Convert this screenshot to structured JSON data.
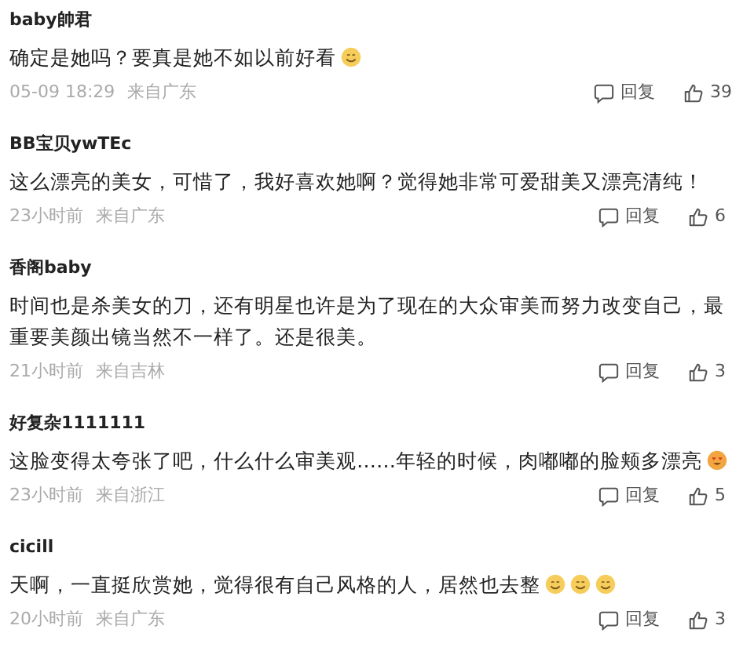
{
  "comments": [
    {
      "user": "baby帥君",
      "text": "确定是她吗？要真是她不如以前好看",
      "emojis": [
        {
          "kind": "smile"
        }
      ],
      "time": "05-09 18:29",
      "location": "来自广东",
      "reply": "回复",
      "likes": "39"
    },
    {
      "user": "BB宝贝ywTEc",
      "text": "这么漂亮的美女，可惜了，我好喜欢她啊？觉得她非常可爱甜美又漂亮清纯！",
      "time": "23小时前",
      "location": "来自广东",
      "reply": "回复",
      "likes": "6"
    },
    {
      "user": "香阁baby",
      "text": "时间也是杀美女的刀，还有明星也许是为了现在的大众审美而努力改变自己，最重要美颜出镜当然不一样了。还是很美。",
      "time": "21小时前",
      "location": "来自吉林",
      "reply": "回复",
      "likes": "3"
    },
    {
      "user": "好复杂1111111",
      "text": "这脸变得太夸张了吧，什么什么审美观……年轻的时候，肉嘟嘟的脸颊多漂亮",
      "emojis": [
        {
          "kind": "heart-eyes"
        }
      ],
      "time": "23小时前",
      "location": "来自浙江",
      "reply": "回复",
      "likes": "5"
    },
    {
      "user": "cicill",
      "text": "天啊，一直挺欣赏她，觉得很有自己风格的人，居然也去整",
      "emojis": [
        {
          "kind": "smile"
        },
        {
          "kind": "smile"
        },
        {
          "kind": "smile"
        }
      ],
      "time": "20小时前",
      "location": "来自广东",
      "reply": "回复",
      "likes": "3"
    }
  ]
}
